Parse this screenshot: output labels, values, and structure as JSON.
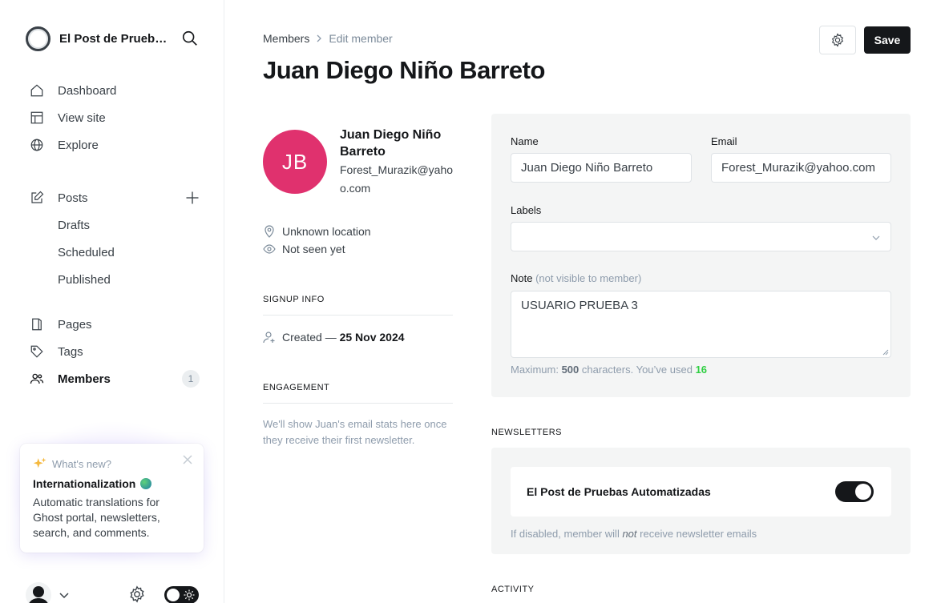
{
  "sidebar": {
    "site_name": "El Post de Pruebas Automatizadas",
    "nav": {
      "dashboard": "Dashboard",
      "view_site": "View site",
      "explore": "Explore",
      "posts": "Posts",
      "drafts": "Drafts",
      "scheduled": "Scheduled",
      "published": "Published",
      "pages": "Pages",
      "tags": "Tags",
      "members": "Members",
      "members_count": "1"
    },
    "whats_new": {
      "header": "What's new?",
      "title": "Internationalization",
      "body": "Automatic translations for Ghost portal, newsletters, search, and comments."
    }
  },
  "header": {
    "breadcrumb_parent": "Members",
    "breadcrumb_current": "Edit member",
    "title": "Juan Diego Niño Barreto",
    "save_label": "Save"
  },
  "profile": {
    "initials": "JB",
    "name": "Juan Diego Niño Barreto",
    "email": "Forest_Murazik@yahoo.com",
    "location": "Unknown location",
    "last_seen": "Not seen yet",
    "signup_heading": "SIGNUP INFO",
    "created_prefix": "Created —",
    "created_date": "25 Nov 2024",
    "engagement_heading": "ENGAGEMENT",
    "engagement_text": "We'll show Juan's email stats here once they receive their first newsletter."
  },
  "form": {
    "name_label": "Name",
    "name_value": "Juan Diego Niño Barreto",
    "email_label": "Email",
    "email_value": "Forest_Murazik@yahoo.com",
    "labels_label": "Labels",
    "note_label": "Note",
    "note_hint": "(not visible to member)",
    "note_value": "USUARIO PRUEBA 3",
    "max_prefix": "Maximum:",
    "max_chars": "500",
    "max_mid": "characters. You’ve used",
    "used_chars": "16"
  },
  "newsletters": {
    "heading": "NEWSLETTERS",
    "name": "El Post de Pruebas Automatizadas",
    "subscribed": true,
    "hint_before": "If disabled, member will",
    "hint_em": "not",
    "hint_after": "receive newsletter emails"
  },
  "activity": {
    "heading": "ACTIVITY"
  },
  "colors": {
    "avatar_bg": "#e0316e",
    "primary": "#15171a",
    "used_count": "#30cf43"
  }
}
